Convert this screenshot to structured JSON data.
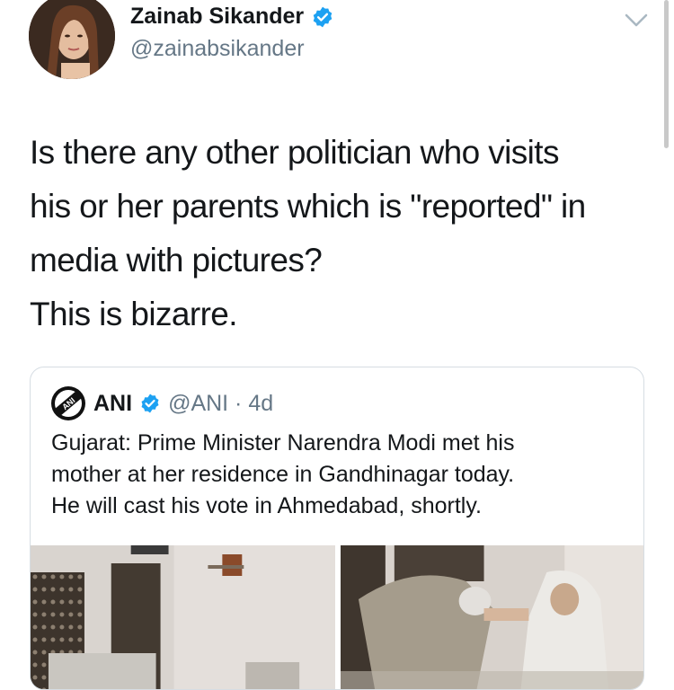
{
  "author": {
    "display_name": "Zainab Sikander",
    "handle": "@zainabsikander",
    "verified": true
  },
  "tweet": {
    "lines": [
      "Is there any other politician who visits",
      "his or her parents which is \"reported\" in",
      "media with pictures?",
      "This is bizarre."
    ]
  },
  "quoted_tweet": {
    "display_name": "ANI",
    "handle_time": "@ANI · 4d",
    "verified": true,
    "logo_text": "ANI",
    "lines": [
      "Gujarat: Prime Minister Narendra Modi met his",
      "mother at her residence in Gandhinagar today.",
      "He will cast his vote in Ahmedabad, shortly."
    ]
  },
  "colors": {
    "verified_blue": "#1da1f2",
    "secondary_text": "#657786",
    "border": "#d6dde3"
  },
  "icons": [
    "verified-badge-icon",
    "chevron-down-icon",
    "ani-logo"
  ]
}
